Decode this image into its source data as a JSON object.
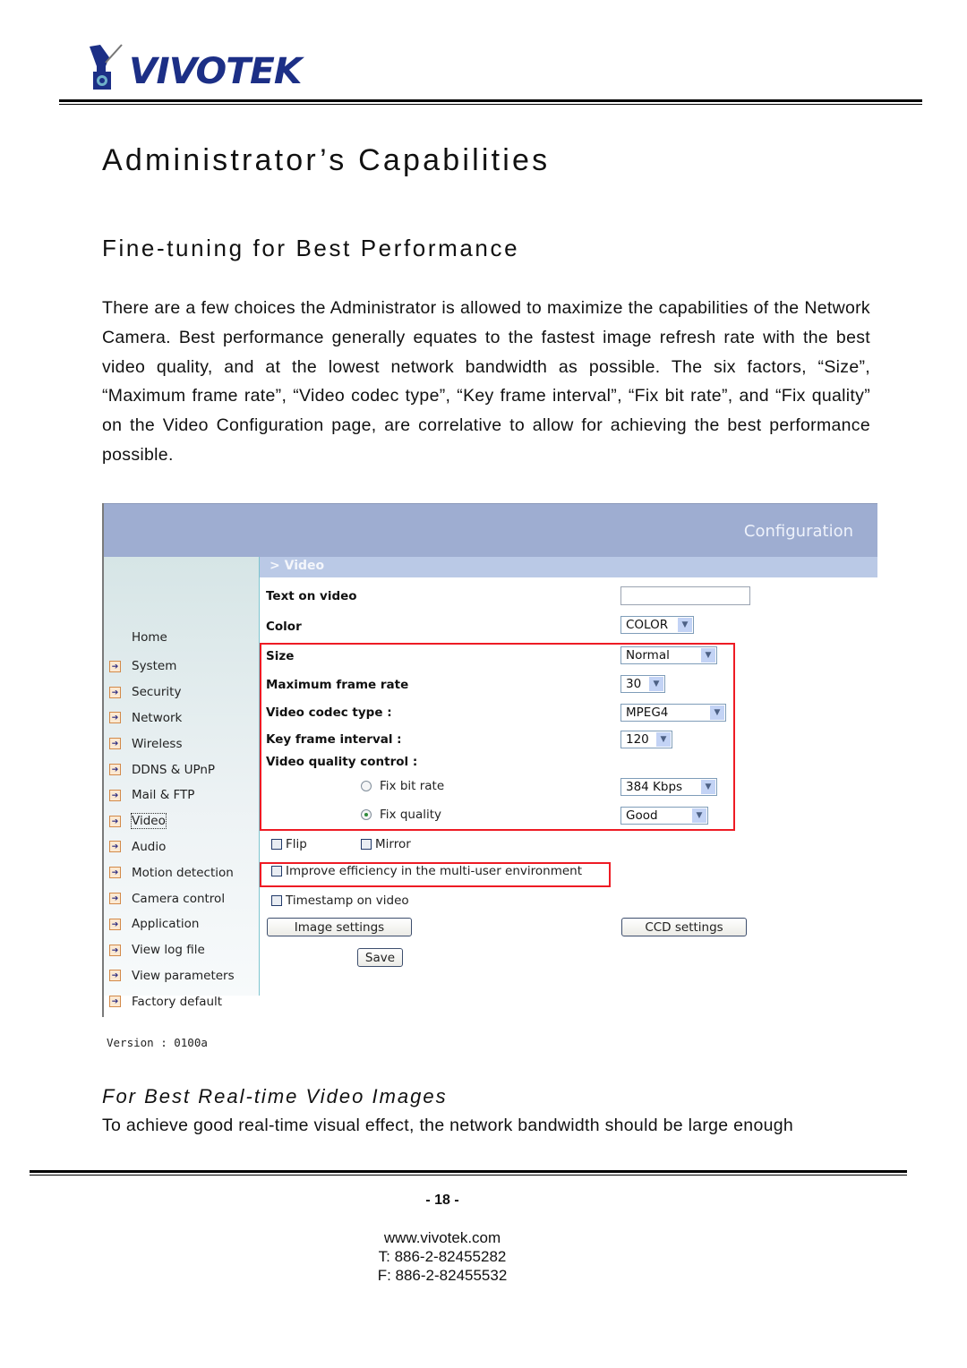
{
  "header": {
    "logo_text": "VIVOTEK",
    "logo_icon": "camera-icon",
    "brand_color": "#1c2f86"
  },
  "document": {
    "title": "Administrator’s Capabilities",
    "section_title": "Fine-tuning for Best Performance",
    "intro_paragraph": "There are a few choices the Administrator is allowed to maximize the capabilities of the Network Camera. Best performance generally equates to the fastest image refresh rate with the best video quality, and at the lowest network bandwidth as possible. The six factors, “Size”, “Maximum frame rate”, “Video codec type”, “Key frame interval”, “Fix bit rate”, and “Fix quality” on the Video Configuration page, are correlative to allow for achieving the best performance possible.",
    "subsection_title": "For Best Real-time Video Images",
    "subsection_paragraph": "To achieve good real-time visual effect, the network bandwidth should be large enough"
  },
  "screenshot": {
    "top_bar_title": "Configuration",
    "breadcrumb": "> Video",
    "sidebar": {
      "home_label": "Home",
      "items": [
        {
          "label": "System",
          "active": false
        },
        {
          "label": "Security",
          "active": false
        },
        {
          "label": "Network",
          "active": false
        },
        {
          "label": "Wireless",
          "active": false
        },
        {
          "label": "DDNS & UPnP",
          "active": false
        },
        {
          "label": "Mail & FTP",
          "active": false
        },
        {
          "label": "Video",
          "active": true
        },
        {
          "label": "Audio",
          "active": false
        },
        {
          "label": "Motion detection",
          "active": false
        },
        {
          "label": "Camera control",
          "active": false
        },
        {
          "label": "Application",
          "active": false
        },
        {
          "label": "View log file",
          "active": false
        },
        {
          "label": "View parameters",
          "active": false
        },
        {
          "label": "Factory default",
          "active": false
        }
      ],
      "version": "Version : 0100a"
    },
    "form": {
      "text_on_video": {
        "label": "Text on video",
        "value": ""
      },
      "color": {
        "label": "Color",
        "value": "COLOR"
      },
      "size": {
        "label": "Size",
        "value": "Normal"
      },
      "max_frame_rate": {
        "label": "Maximum frame rate",
        "value": "30"
      },
      "codec_type": {
        "label": "Video codec type :",
        "value": "MPEG4"
      },
      "key_frame_interval": {
        "label": "Key frame interval :",
        "value": "120"
      },
      "quality_control_label": "Video quality control :",
      "fix_bit_rate": {
        "label": "Fix bit rate",
        "selected": false,
        "value": "384 Kbps"
      },
      "fix_quality": {
        "label": "Fix quality",
        "selected": true,
        "value": "Good"
      },
      "flip": {
        "label": "Flip",
        "checked": false
      },
      "mirror": {
        "label": "Mirror",
        "checked": false
      },
      "multi_user": {
        "label": "Improve efficiency in the multi-user environment",
        "checked": false
      },
      "timestamp": {
        "label": "Timestamp on video",
        "checked": false
      },
      "image_settings_button": "Image settings",
      "ccd_settings_button": "CCD settings",
      "save_button": "Save"
    },
    "highlight_color": "#ee1b24"
  },
  "footer": {
    "page_number": "- 18 -",
    "website": "www.vivotek.com",
    "phone": "T: 886-2-82455282",
    "fax": "F: 886-2-82455532"
  }
}
